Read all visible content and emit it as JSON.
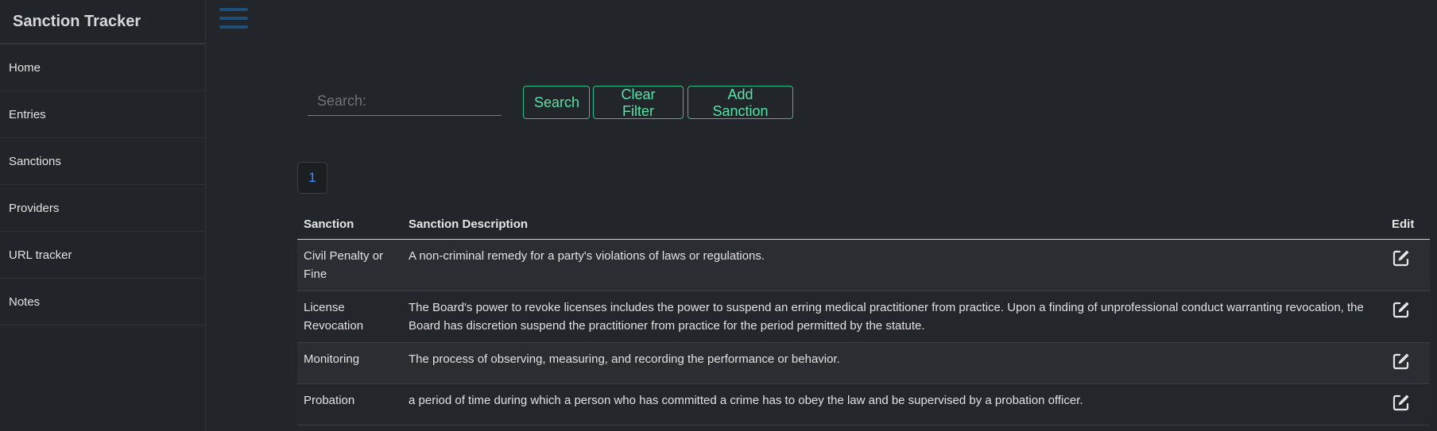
{
  "sidebar": {
    "title": "Sanction Tracker",
    "items": [
      {
        "label": "Home"
      },
      {
        "label": "Entries"
      },
      {
        "label": "Sanctions"
      },
      {
        "label": "Providers"
      },
      {
        "label": "URL tracker"
      },
      {
        "label": "Notes"
      }
    ]
  },
  "toolbar": {
    "search_placeholder": "Search:",
    "search_label": "Search",
    "clear_label": "Clear Filter",
    "add_label": "Add Sanction"
  },
  "pagination": {
    "current_page": "1"
  },
  "table": {
    "headers": {
      "sanction": "Sanction",
      "description": "Sanction Description",
      "edit": "Edit"
    },
    "rows": [
      {
        "sanction": "Civil Penalty or Fine",
        "description": "A non-criminal remedy for a party's violations of laws or regulations."
      },
      {
        "sanction": "License Revocation",
        "description": "The Board's power to revoke licenses includes the power to suspend an erring medical practitioner from practice. Upon a finding of unprofessional conduct warranting revocation, the Board has discretion suspend the practitioner from practice for the period permitted by the statute."
      },
      {
        "sanction": "Monitoring",
        "description": "The process of observing, measuring, and recording the performance or behavior."
      },
      {
        "sanction": "Probation",
        "description": "a period of time during which a person who has committed a crime has to obey the law and be supervised by a probation officer."
      }
    ]
  },
  "colors": {
    "accent": "#57e3a7",
    "page_link": "#3d8bfd",
    "hamburger": "#1e4f78",
    "background": "#22262a"
  },
  "icons": {
    "menu": "hamburger-menu-icon",
    "edit": "edit-icon"
  }
}
